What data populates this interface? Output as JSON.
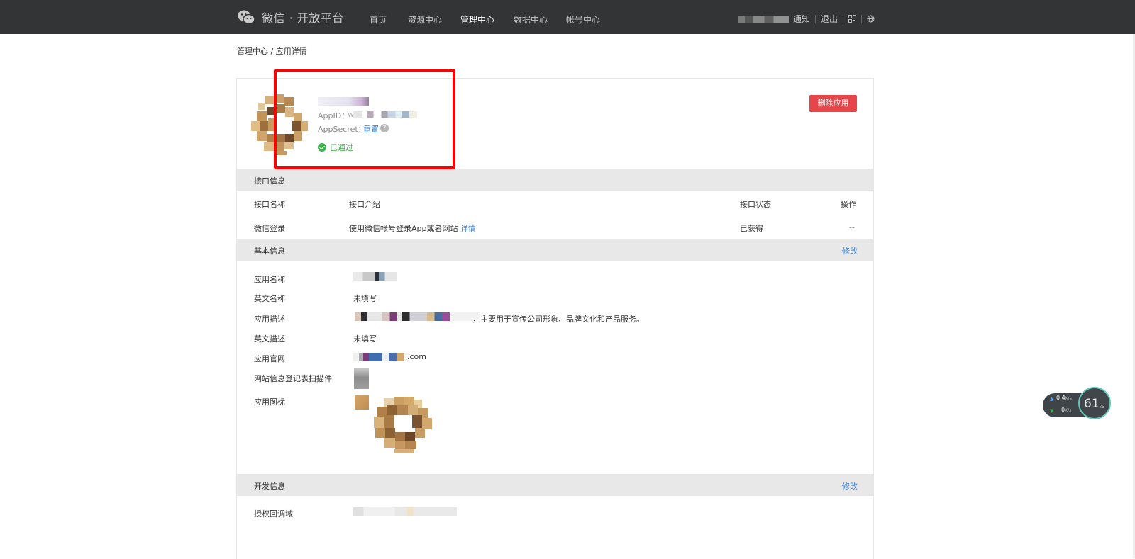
{
  "header": {
    "logo_icon": "wechat-logo-icon",
    "title": "微信 · 开放平台",
    "nav": [
      {
        "label": "首页"
      },
      {
        "label": "资源中心"
      },
      {
        "label": "管理中心",
        "active": true
      },
      {
        "label": "数据中心"
      },
      {
        "label": "帐号中心"
      }
    ],
    "notify": "通知",
    "logout": "退出",
    "qr_icon": "qrcode-icon",
    "globe_icon": "globe-icon"
  },
  "breadcrumb": "管理中心 / 应用详情",
  "app": {
    "appid_label": "AppID：",
    "appid_value": "wx",
    "secret_label": "AppSecret：",
    "secret_reset": "重置",
    "help_icon": "question-icon",
    "help_glyph": "?",
    "status": "已通过",
    "status_icon": "check-circle-icon",
    "delete_button": "删除应用"
  },
  "interface": {
    "title": "接口信息",
    "columns": [
      "接口名称",
      "接口介绍",
      "接口状态",
      "操作"
    ],
    "row": {
      "name": "微信登录",
      "desc": "使用微信帐号登录App或者网站",
      "detail_link": "详情",
      "status": "已获得",
      "action": "--"
    }
  },
  "basic": {
    "title": "基本信息",
    "edit": "修改",
    "fields": {
      "name": "应用名称",
      "en_name": "英文名称",
      "en_name_value": "未填写",
      "desc": "应用描述",
      "desc_value_tail": "，主要用于宣传公司形象、品牌文化和产品服务。",
      "en_desc": "英文描述",
      "en_desc_value": "未填写",
      "website": "应用官网",
      "website_value_tail": ".com",
      "scan_plugin": "网站信息登记表扫描件",
      "icon": "应用图标"
    }
  },
  "dev": {
    "title": "开发信息",
    "edit": "修改",
    "domain_label": "授权回调域"
  },
  "net_widget": {
    "up": "0.4",
    "up_unit": "K/s",
    "down": "0",
    "down_unit": "K/s",
    "percent": "61",
    "percent_sign": "%"
  }
}
